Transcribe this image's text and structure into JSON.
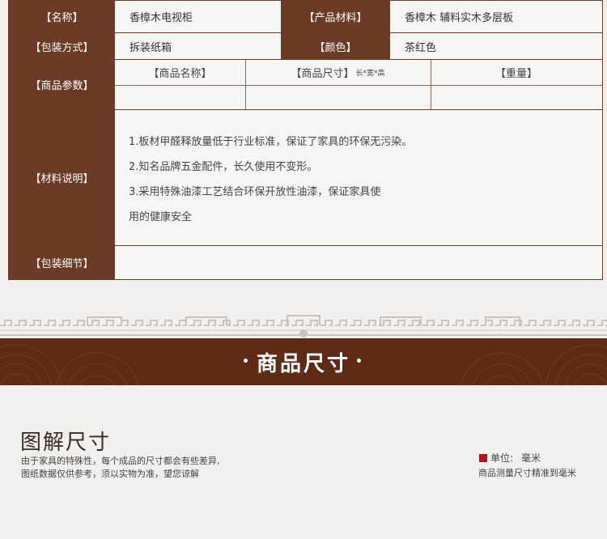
{
  "specs": {
    "name_label": "【名称】",
    "name_value": "香樟木电视柜",
    "material_label": "【产品材料】",
    "material_value": "香樟木  辅料实木多层板",
    "packaging_label": "【包装方式】",
    "packaging_value": "拆装纸箱",
    "color_label": "【颜色】",
    "color_value": "茶红色",
    "params_label": "【商品参数】",
    "params_headers": {
      "product_name": "【商品名称】",
      "product_size": "【商品尺寸】",
      "product_size_note": "长*宽*高",
      "weight": "【重量】"
    },
    "params_values": {
      "product_name": "",
      "product_size": "",
      "weight": ""
    },
    "materials_label": "【材料说明】",
    "materials_lines": [
      "1.板材甲醛释放量低于行业标准，保证了家具的环保无污染。",
      "2.知名品牌五金配件，长久使用不变形。",
      "3.采用特殊油漆工艺结合环保开放性油漆，保证家具使",
      "用的健康安全"
    ],
    "packaging_detail_label": "【包装细节】",
    "packaging_detail_value": ""
  },
  "banner": {
    "title": "商品尺寸",
    "dot": "•"
  },
  "diagram": {
    "heading": "图解尺寸",
    "desc_line1": "由于家具的特殊性，每个成品的尺寸都会有些差异,",
    "desc_line2": "图纸数据仅供参考，须以实物为准，望您谅解",
    "unit_label": "单位:",
    "unit_value": "毫米",
    "precision_note": "商品测量尺寸精准到毫米"
  },
  "colors": {
    "label_bg": "#6b3b26",
    "banner_bg": "#5e2c16",
    "unit_square": "#b2161c",
    "pattern": "#c9c3bd"
  }
}
